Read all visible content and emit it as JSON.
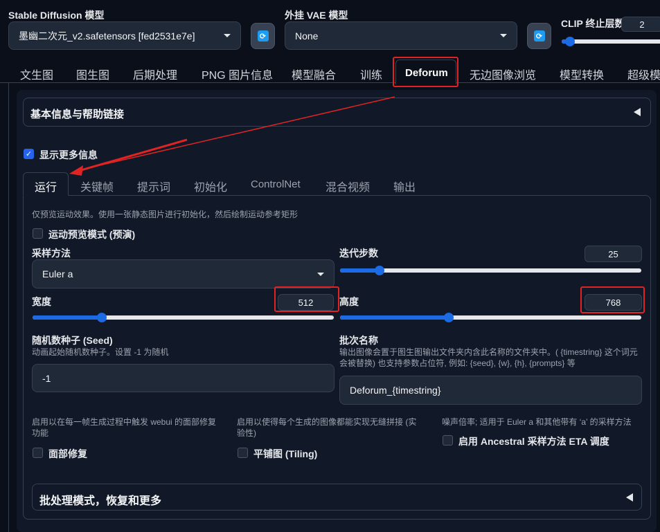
{
  "top": {
    "model_label": "Stable Diffusion 模型",
    "model_value": "墨幽二次元_v2.safetensors [fed2531e7e]",
    "vae_label": "外挂 VAE 模型",
    "vae_value": "None",
    "clip_label": "CLIP 终止层数",
    "clip_value": "2",
    "clip_level": 0.08
  },
  "main_tabs": [
    "文生图",
    "图生图",
    "后期处理",
    "PNG 图片信息",
    "模型融合",
    "训练",
    "Deforum",
    "无边图像浏览",
    "模型转换",
    "超级模"
  ],
  "active_main_tab": "Deforum",
  "info_accordion": "基本信息与帮助链接",
  "show_more": "显示更多信息",
  "sub_tabs": [
    "运行",
    "关键帧",
    "提示词",
    "初始化",
    "ControlNet",
    "混合视频",
    "输出"
  ],
  "active_sub_tab": "运行",
  "run": {
    "preview_hint": "仅预览运动效果。使用一张静态图片进行初始化，然后绘制运动参考矩形",
    "preview_mode": "运动预览模式 (预演)",
    "sampler_label": "采样方法",
    "sampler_value": "Euler a",
    "steps_label": "迭代步数",
    "steps_value": "25",
    "steps_level": 0.13,
    "width_label": "宽度",
    "width_value": "512",
    "width_level": 0.23,
    "height_label": "高度",
    "height_value": "768",
    "height_level": 0.36,
    "seed_label": "随机数种子 (Seed)",
    "seed_desc": "动画起始随机数种子。设置 -1 为随机",
    "seed_value": "-1",
    "batch_label": "批次名称",
    "batch_desc1": "输出图像会置于图生图输出文件夹内含此名称的文件夹中。( {timestring} 这个词元",
    "batch_desc2": "会被替换) 也支持参数占位符, 例如: {seed}, {w}, {h}, {prompts} 等",
    "batch_value": "Deforum_{timestring}",
    "face_desc1": "启用以在每一帧生成过程中触发 webui 的面部修复",
    "face_desc2": "功能",
    "face_label": "面部修复",
    "tiling_desc1": "启用以使得每个生成的图像都能实现无缝拼接 (实",
    "tiling_desc2": "验性)",
    "tiling_label": "平铺图 (Tiling)",
    "eta_desc": "噪声倍率; 适用于 Euler a 和其他带有 ‘a’ 的采样方法",
    "eta_label": "启用 Ancestral 采样方法 ETA 调度",
    "batch_mode_accordion": "批处理模式，恢复和更多"
  },
  "colors": {
    "accent": "#1d6ae5",
    "annotation": "#e02424",
    "background": "#0b0f19"
  }
}
